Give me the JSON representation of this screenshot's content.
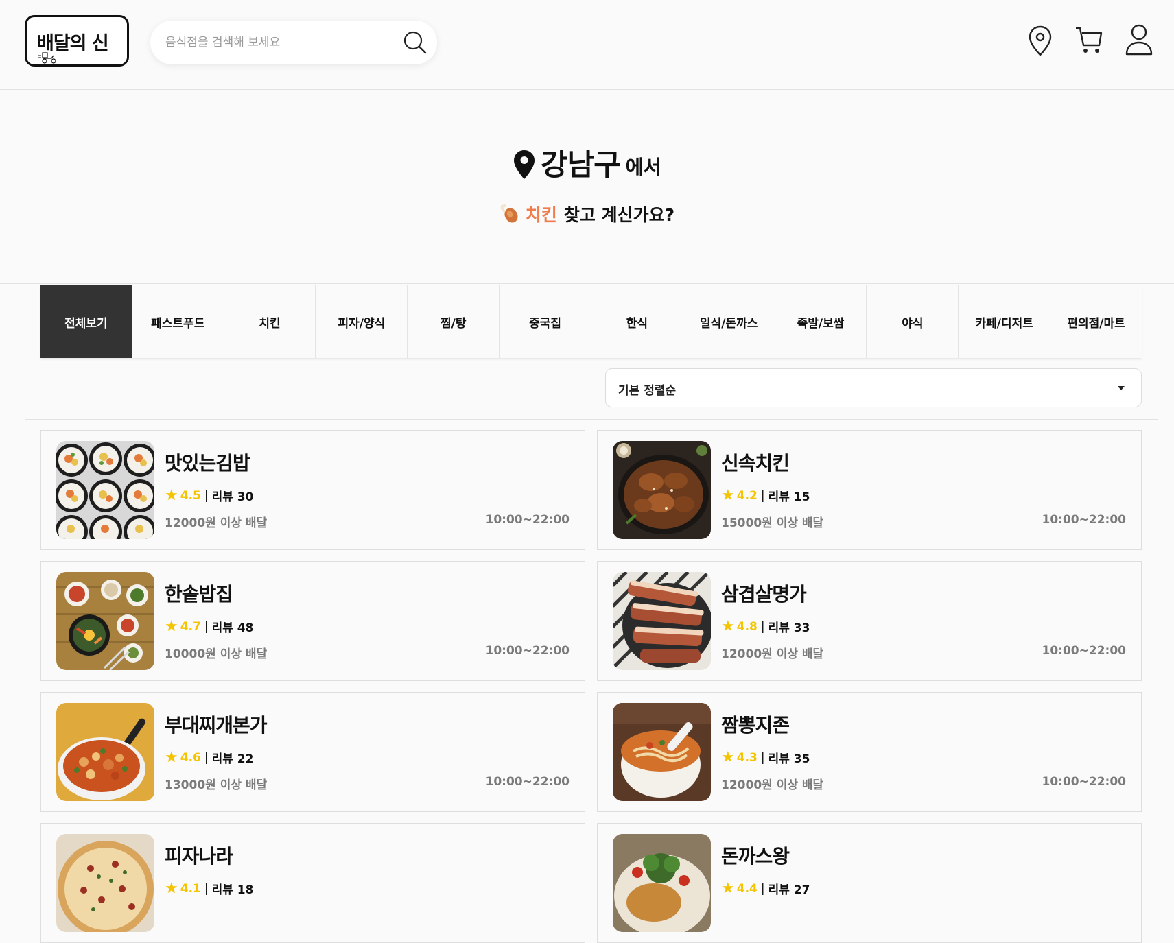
{
  "header": {
    "logo_text": "배달의 신",
    "search_placeholder": "음식점을 검색해 보세요"
  },
  "hero": {
    "district": "강남구",
    "district_suffix": "에서",
    "category": "치킨",
    "question": "찾고 계신가요?"
  },
  "categories": [
    {
      "label": "전체보기",
      "active": true
    },
    {
      "label": "패스트푸드"
    },
    {
      "label": "치킨"
    },
    {
      "label": "피자/양식"
    },
    {
      "label": "찜/탕"
    },
    {
      "label": "중국집"
    },
    {
      "label": "한식"
    },
    {
      "label": "일식/돈까스"
    },
    {
      "label": "족발/보쌈"
    },
    {
      "label": "야식"
    },
    {
      "label": "카페/디저트"
    },
    {
      "label": "편의점/마트"
    }
  ],
  "sort": {
    "selected": "기본 정렬순"
  },
  "restaurants": [
    {
      "name": "맛있는김밥",
      "rating": "4.5",
      "review_label": "리뷰 30",
      "min_order": "12000원 이상 배달",
      "hours": "10:00~22:00",
      "food": "kimbap"
    },
    {
      "name": "신속치킨",
      "rating": "4.2",
      "review_label": "리뷰 15",
      "min_order": "15000원 이상 배달",
      "hours": "10:00~22:00",
      "food": "chicken"
    },
    {
      "name": "한솥밥집",
      "rating": "4.7",
      "review_label": "리뷰 48",
      "min_order": "10000원 이상 배달",
      "hours": "10:00~22:00",
      "food": "bibimbap"
    },
    {
      "name": "삼겹살명가",
      "rating": "4.8",
      "review_label": "리뷰 33",
      "min_order": "12000원 이상 배달",
      "hours": "10:00~22:00",
      "food": "pork"
    },
    {
      "name": "부대찌개본가",
      "rating": "4.6",
      "review_label": "리뷰 22",
      "min_order": "13000원 이상 배달",
      "hours": "10:00~22:00",
      "food": "stew"
    },
    {
      "name": "짬뽕지존",
      "rating": "4.3",
      "review_label": "리뷰 35",
      "min_order": "12000원 이상 배달",
      "hours": "10:00~22:00",
      "food": "noodle"
    },
    {
      "name": "피자나라",
      "rating": "4.1",
      "review_label": "리뷰 18",
      "food": "pizza"
    },
    {
      "name": "돈까스왕",
      "rating": "4.4",
      "review_label": "리뷰 27",
      "food": "cutlet"
    }
  ]
}
